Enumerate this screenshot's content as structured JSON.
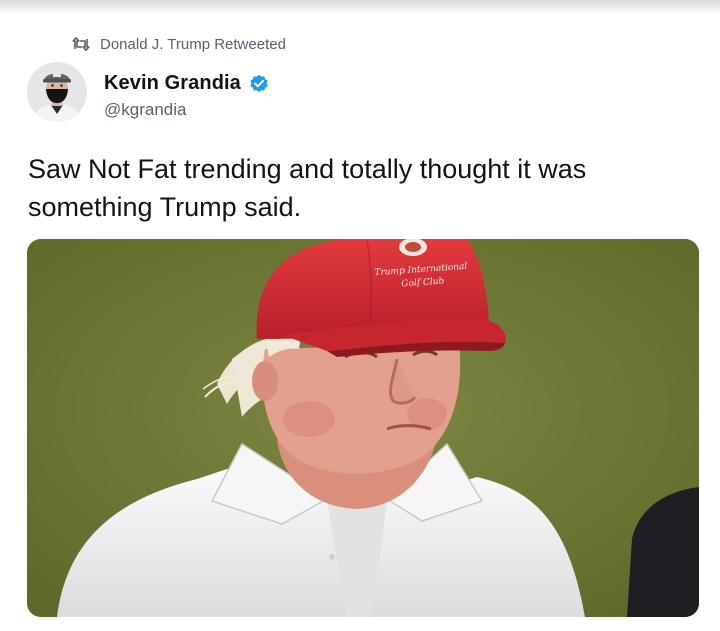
{
  "social_context": {
    "text": "Donald J. Trump Retweeted",
    "icon": "retweet-icon"
  },
  "author": {
    "display_name": "Kevin Grandia",
    "handle": "@kgrandia",
    "verified": true,
    "verified_color": "#1d9bf0"
  },
  "tweet": {
    "text_line1": "Saw Not Fat trending and totally thought it was",
    "text_line2": "something Trump said."
  },
  "media": {
    "cap_embroidery_line1": "Trump International",
    "cap_embroidery_line2": "Golf Club"
  },
  "colors": {
    "text_primary": "#0f1419",
    "text_secondary": "#536471",
    "cap_red": "#d42a33",
    "background_green": "#6f7a37"
  }
}
